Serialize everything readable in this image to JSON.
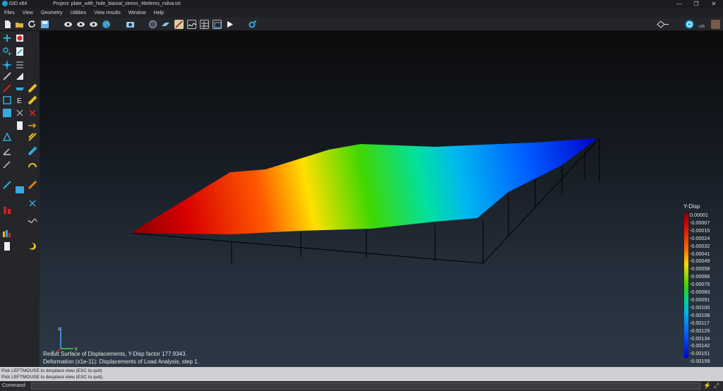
{
  "window": {
    "app_title": "GiD x64",
    "project_title": "Project: plate_with_hole_biaxial_stress_46elems_rsilva.txt",
    "minimize": "—",
    "restore": "❐",
    "close": "✕"
  },
  "menu": {
    "items": [
      "Files",
      "View",
      "Geometry",
      "Utilities",
      "View results",
      "Window",
      "Help"
    ]
  },
  "toolbar": {
    "right_badge": "v15"
  },
  "viewport": {
    "info_line1": "Result Surface of Displacements, Y-Disp factor 177.9343.",
    "info_line2": "Deformation (x1e-11): Displacements of Load Analysis, step 1.",
    "axis_x": "x",
    "axis_y": "y",
    "axis_z": "z"
  },
  "legend": {
    "title": "Y-Disp",
    "values": [
      "0.00001",
      "-0.00007",
      "-0.00015",
      "-0.00024",
      "-0.00032",
      "-0.00041",
      "-0.00049",
      "-0.00058",
      "-0.00066",
      "-0.00075",
      "-0.00083",
      "-0.00091",
      "-0.00100",
      "-0.00108",
      "-0.00117",
      "-0.00125",
      "-0.00134",
      "-0.00142",
      "-0.00151",
      "-0.00159"
    ]
  },
  "command_log": {
    "line1": "Pick LEFTMOUSE to desplace view (ESC to quit)",
    "line2": "Pick LEFTMOUSE to desplace view (ESC to quit)."
  },
  "command_bar": {
    "label": "Command:",
    "value": ""
  }
}
